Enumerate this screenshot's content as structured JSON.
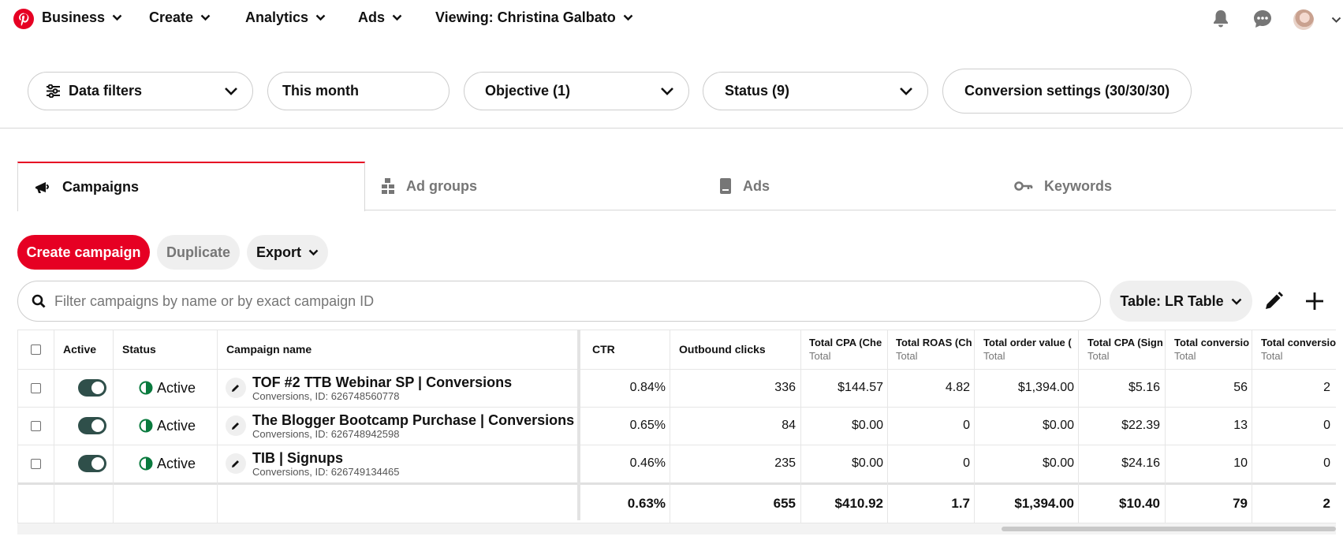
{
  "topnav": {
    "items": [
      {
        "label": "Business"
      },
      {
        "label": "Create"
      },
      {
        "label": "Analytics"
      },
      {
        "label": "Ads"
      },
      {
        "label": "Viewing: Christina Galbato"
      }
    ]
  },
  "filters": {
    "data_filters": "Data filters",
    "date_range": "This month",
    "objective": "Objective (1)",
    "status": "Status (9)",
    "conversion_settings": "Conversion settings (30/30/30)"
  },
  "tabs": [
    {
      "label": "Campaigns",
      "icon": "megaphone-icon",
      "active": true
    },
    {
      "label": "Ad groups",
      "icon": "ad-groups-icon",
      "active": false
    },
    {
      "label": "Ads",
      "icon": "ad-icon",
      "active": false
    },
    {
      "label": "Keywords",
      "icon": "key-icon",
      "active": false
    }
  ],
  "actions": {
    "create": "Create campaign",
    "duplicate": "Duplicate",
    "export": "Export"
  },
  "search": {
    "placeholder": "Filter campaigns by name or by exact campaign ID",
    "value": ""
  },
  "table_selector": "Table: LR Table",
  "table": {
    "headers": {
      "active": "Active",
      "status": "Status",
      "campaign_name": "Campaign name",
      "ctr": "CTR",
      "outbound_clicks": "Outbound clicks",
      "total_cpa_che": "Total CPA (Che",
      "total_roas_ch": "Total ROAS (Ch",
      "total_order_value": "Total order value (",
      "total_cpa_sign": "Total CPA (Sign",
      "total_conv_1": "Total conversio",
      "total_conv_2": "Total conversio",
      "sub": "Total"
    },
    "rows": [
      {
        "status": "Active",
        "name": "TOF #2 TTB Webinar SP | Conversions",
        "meta": "Conversions, ID: 626748560778",
        "ctr": "0.84%",
        "outbound": "336",
        "cpa_che": "$144.57",
        "roas": "4.82",
        "order_value": "$1,394.00",
        "cpa_sign": "$5.16",
        "conv1": "56",
        "conv2": "2"
      },
      {
        "status": "Active",
        "name": "The Blogger Bootcamp Purchase | Conversions",
        "meta": "Conversions, ID: 626748942598",
        "ctr": "0.65%",
        "outbound": "84",
        "cpa_che": "$0.00",
        "roas": "0",
        "order_value": "$0.00",
        "cpa_sign": "$22.39",
        "conv1": "13",
        "conv2": "0"
      },
      {
        "status": "Active",
        "name": "TIB | Signups",
        "meta": "Conversions, ID: 626749134465",
        "ctr": "0.46%",
        "outbound": "235",
        "cpa_che": "$0.00",
        "roas": "0",
        "order_value": "$0.00",
        "cpa_sign": "$24.16",
        "conv1": "10",
        "conv2": "0"
      }
    ],
    "totals": {
      "ctr": "0.63%",
      "outbound": "655",
      "cpa_che": "$410.92",
      "roas": "1.7",
      "order_value": "$1,394.00",
      "cpa_sign": "$10.40",
      "conv1": "79",
      "conv2": "2"
    }
  },
  "colors": {
    "brand": "#e60023",
    "toggle_on": "#2f4f4a",
    "status_active": "#0a7a3e"
  }
}
